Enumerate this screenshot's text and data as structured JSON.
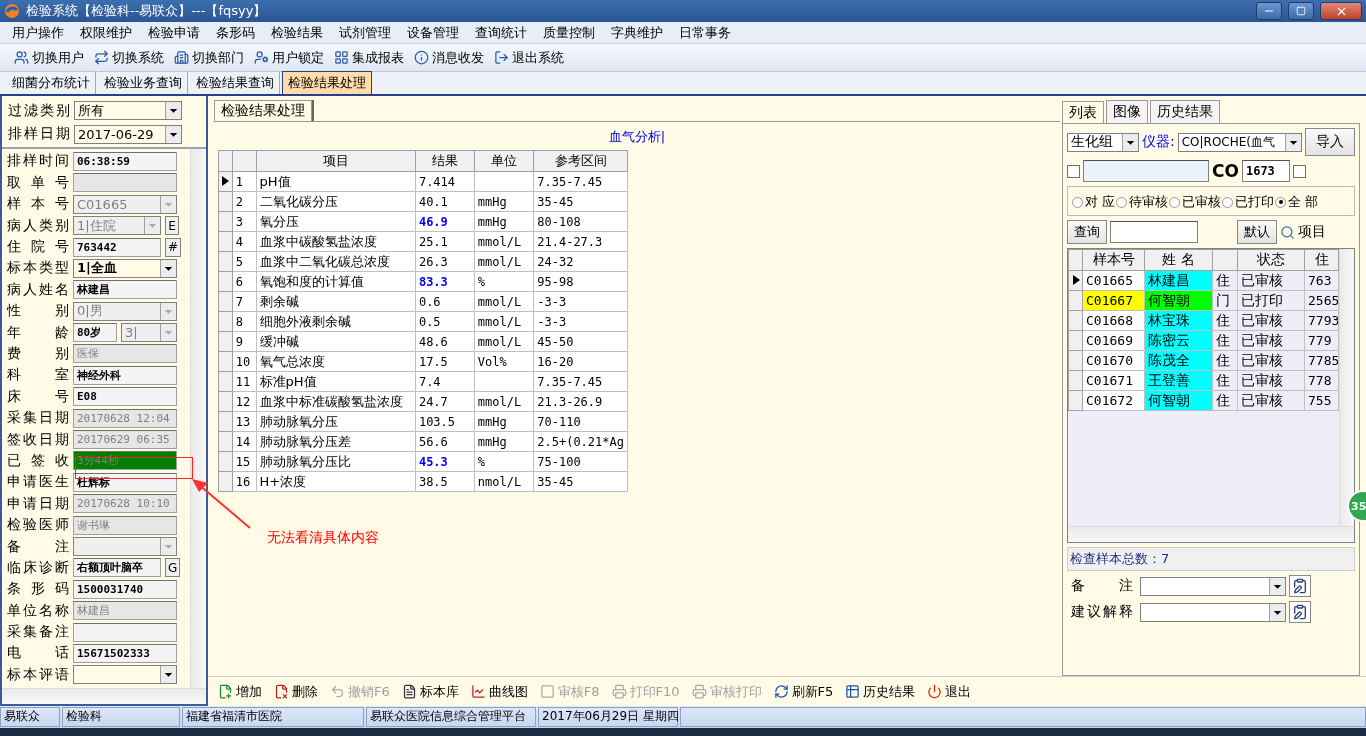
{
  "window": {
    "title": "检验系统【检验科--易联众】---【fqsyy】"
  },
  "menu": [
    "用户操作",
    "权限维护",
    "检验申请",
    "条形码",
    "检验结果",
    "试剂管理",
    "设备管理",
    "查询统计",
    "质量控制",
    "字典维护",
    "日常事务"
  ],
  "toolbar": [
    "切换用户",
    "切换系统",
    "切换部门",
    "用户锁定",
    "集成报表",
    "消息收发",
    "退出系统"
  ],
  "tabs": [
    {
      "label": "细菌分布统计",
      "selected": false
    },
    {
      "label": "检验业务查询",
      "selected": false
    },
    {
      "label": "检验结果查询",
      "selected": false
    },
    {
      "label": "检验结果处理",
      "selected": true
    }
  ],
  "filter": [
    {
      "label": "过滤类别",
      "value": "所有"
    },
    {
      "label": "排样日期",
      "value": "2017-06-29"
    }
  ],
  "fields": [
    {
      "label": "排样时间",
      "value": "06:38:59",
      "kind": "text",
      "disabled": false
    },
    {
      "label": "取 单 号",
      "kind": "text",
      "disabled": true
    },
    {
      "label": "样 本 号",
      "value": "C01665",
      "kind": "combo",
      "disabled": true
    },
    {
      "label": "病人类别",
      "value": "1|住院",
      "kind": "combo",
      "disabled": true,
      "button": "E"
    },
    {
      "label": "住 院 号",
      "value": "763442",
      "kind": "text",
      "disabled": false,
      "button": "#"
    },
    {
      "label": "标本类型",
      "value": "1|全血",
      "kind": "combo",
      "disabled": false
    },
    {
      "label": "病人姓名",
      "value": "林建昌",
      "kind": "text",
      "disabled": false
    },
    {
      "label": "性 别",
      "value": "0|男",
      "kind": "combo",
      "disabled": true
    },
    {
      "label": "年 龄",
      "value": "80岁",
      "unit": "3|",
      "kind": "age",
      "disabled": false
    },
    {
      "label": "费 别",
      "value": "医保",
      "kind": "text",
      "disabled": true
    },
    {
      "label": "科 室",
      "value": "神经外科",
      "kind": "text",
      "disabled": false
    },
    {
      "label": "床 号",
      "value": "E08",
      "kind": "text",
      "disabled": false
    },
    {
      "label": "采集日期",
      "value": "20170628 12:04",
      "kind": "text",
      "disabled": true
    },
    {
      "label": "签收日期",
      "value": "20170629 06:35",
      "kind": "text",
      "disabled": true
    },
    {
      "label": "已 签 收",
      "value": "3分44秒",
      "kind": "status",
      "disabled": true
    },
    {
      "label": "申请医生",
      "value": "杜辉标",
      "kind": "text",
      "disabled": false
    },
    {
      "label": "申请日期",
      "value": "20170628 10:10",
      "kind": "text",
      "disabled": true
    },
    {
      "label": "检验医师",
      "value": "谢书琳",
      "kind": "text",
      "disabled": true
    },
    {
      "label": "备 注",
      "kind": "combo",
      "disabled": true
    },
    {
      "label": "临床诊断",
      "value": "右额顶叶脑卒",
      "kind": "text",
      "disabled": false,
      "button": "G"
    },
    {
      "label": "条 形 码",
      "value": "1500031740",
      "kind": "text",
      "disabled": false
    },
    {
      "label": "单位名称",
      "value": "林建昌",
      "kind": "text",
      "disabled": true
    },
    {
      "label": "采集备注",
      "kind": "text",
      "disabled": false
    },
    {
      "label": "电 话",
      "value": "15671502333",
      "kind": "text",
      "disabled": false
    },
    {
      "label": "标本评语",
      "kind": "combo",
      "disabled": false
    }
  ],
  "page_tab": {
    "label": "检验结果处理",
    "selected": true
  },
  "report_title": "血气分析|",
  "results": {
    "columns": [
      "项目",
      "结果",
      "单位",
      "参考区间"
    ],
    "rows": [
      {
        "no": "1",
        "item": "pH值",
        "result": "7.414",
        "range": "7.35-7.45",
        "abnormal": false,
        "selected": true
      },
      {
        "no": "2",
        "item": "二氧化碳分压",
        "result": "40.1",
        "unit": "mmHg",
        "range": "35-45",
        "abnormal": false,
        "selected": false
      },
      {
        "no": "3",
        "item": "氧分压",
        "result": "46.9",
        "unit": "mmHg",
        "range": "80-108",
        "abnormal": true,
        "selected": false
      },
      {
        "no": "4",
        "item": "血浆中碳酸氢盐浓度",
        "result": "25.1",
        "unit": "mmol/L",
        "range": "21.4-27.3",
        "abnormal": false,
        "selected": false
      },
      {
        "no": "5",
        "item": "血浆中二氧化碳总浓度",
        "result": "26.3",
        "unit": "mmol/L",
        "range": "24-32",
        "abnormal": false,
        "selected": false
      },
      {
        "no": "6",
        "item": "氧饱和度的计算值",
        "result": "83.3",
        "unit": "%",
        "range": "95-98",
        "abnormal": true,
        "selected": false
      },
      {
        "no": "7",
        "item": "剩余碱",
        "result": "0.6",
        "unit": "mmol/L",
        "range": "-3-3",
        "abnormal": false,
        "selected": false
      },
      {
        "no": "8",
        "item": "细胞外液剩余碱",
        "result": "0.5",
        "unit": "mmol/L",
        "range": "-3-3",
        "abnormal": false,
        "selected": false
      },
      {
        "no": "9",
        "item": "缓冲碱",
        "result": "48.6",
        "unit": "mmol/L",
        "range": "45-50",
        "abnormal": false,
        "selected": false
      },
      {
        "no": "10",
        "item": "氧气总浓度",
        "result": "17.5",
        "unit": "Vol%",
        "range": "16-20",
        "abnormal": false,
        "selected": false
      },
      {
        "no": "11",
        "item": "标准pH值",
        "result": "7.4",
        "range": "7.35-7.45",
        "abnormal": false,
        "selected": false
      },
      {
        "no": "12",
        "item": "血浆中标准碳酸氢盐浓度",
        "result": "24.7",
        "unit": "mmol/L",
        "range": "21.3-26.9",
        "abnormal": false,
        "selected": false
      },
      {
        "no": "13",
        "item": "肺动脉氧分压",
        "result": "103.5",
        "unit": "mmHg",
        "range": "70-110",
        "abnormal": false,
        "selected": false
      },
      {
        "no": "14",
        "item": "肺动脉氧分压差",
        "result": "56.6",
        "unit": "mmHg",
        "range": "2.5+(0.21*Ag",
        "abnormal": false,
        "selected": false
      },
      {
        "no": "15",
        "item": "肺动脉氧分压比",
        "result": "45.3",
        "unit": "%",
        "range": "75-100",
        "abnormal": true,
        "selected": false
      },
      {
        "no": "16",
        "item": "H+浓度",
        "result": "38.5",
        "unit": "nmol/L",
        "range": "35-45",
        "abnormal": false,
        "selected": false
      }
    ]
  },
  "right_tabs": [
    {
      "label": "列表",
      "selected": true
    },
    {
      "label": "图像",
      "selected": false
    },
    {
      "label": "历史结果",
      "selected": false
    }
  ],
  "group_select": "生化组",
  "instrument_label": "仪器:",
  "instrument_select": "CO|ROCHE(血气",
  "import_button": "导入",
  "code_prefix": "CO",
  "code_value": "1673",
  "checkboxes": [
    {
      "checked": false
    },
    {
      "checked": false
    }
  ],
  "radios": [
    {
      "label": "对 应",
      "selected": false
    },
    {
      "label": "待审核",
      "selected": false
    },
    {
      "label": "已审核",
      "selected": false
    },
    {
      "label": "已打印",
      "selected": false
    },
    {
      "label": "全 部",
      "selected": true
    }
  ],
  "query_button": "查询",
  "default_button": "默认",
  "items_link": "项目",
  "samples": {
    "columns": [
      "样本号",
      "姓 名",
      "",
      "状态",
      "住"
    ],
    "rows": [
      {
        "no": "C01665",
        "name": "林建昌",
        "type": "住",
        "status": "已审核",
        "id": "763",
        "color": "#00ffff",
        "highlighted": false,
        "selected": true
      },
      {
        "no": "C01667",
        "name": "何智朝",
        "type": "门",
        "status": "已打印",
        "id": "2565",
        "color": "#00ff00",
        "highlighted": true,
        "selected": false
      },
      {
        "no": "C01668",
        "name": "林宝珠",
        "type": "住",
        "status": "已审核",
        "id": "7793",
        "color": "#00ffff",
        "highlighted": false,
        "selected": false
      },
      {
        "no": "C01669",
        "name": "陈密云",
        "type": "住",
        "status": "已审核",
        "id": "779",
        "color": "#00ffff",
        "highlighted": false,
        "selected": false
      },
      {
        "no": "C01670",
        "name": "陈茂全",
        "type": "住",
        "status": "已审核",
        "id": "7785",
        "color": "#00ffff",
        "highlighted": false,
        "selected": false
      },
      {
        "no": "C01671",
        "name": "王登善",
        "type": "住",
        "status": "已审核",
        "id": "778",
        "color": "#00ffff",
        "highlighted": false,
        "selected": false
      },
      {
        "no": "C01672",
        "name": "何智朝",
        "type": "住",
        "status": "已审核",
        "id": "755",
        "color": "#00ffff",
        "highlighted": false,
        "selected": false
      }
    ]
  },
  "sample_total": "检查样本总数：7",
  "notes": [
    {
      "label": "备 注"
    },
    {
      "label": "建议解释"
    }
  ],
  "actions": [
    {
      "label": "增加",
      "disabled": false
    },
    {
      "label": "删除",
      "disabled": false
    },
    {
      "label": "撤销F6",
      "disabled": true
    },
    {
      "label": "标本库",
      "disabled": false
    },
    {
      "label": "曲线图",
      "disabled": false
    },
    {
      "label": "审核F8",
      "disabled": true
    },
    {
      "label": "打印F10",
      "disabled": true
    },
    {
      "label": "审核打印",
      "disabled": true
    },
    {
      "label": "刷新F5",
      "disabled": false
    },
    {
      "label": "历史结果",
      "disabled": false
    },
    {
      "label": "退出",
      "disabled": false
    }
  ],
  "status_bar": [
    "易联众",
    "检验科",
    "福建省福清市医院",
    "易联众医院信息综合管理平台",
    "2017年06月29日 星期四"
  ],
  "annotation": "无法看清具体内容",
  "side_badge": "35"
}
